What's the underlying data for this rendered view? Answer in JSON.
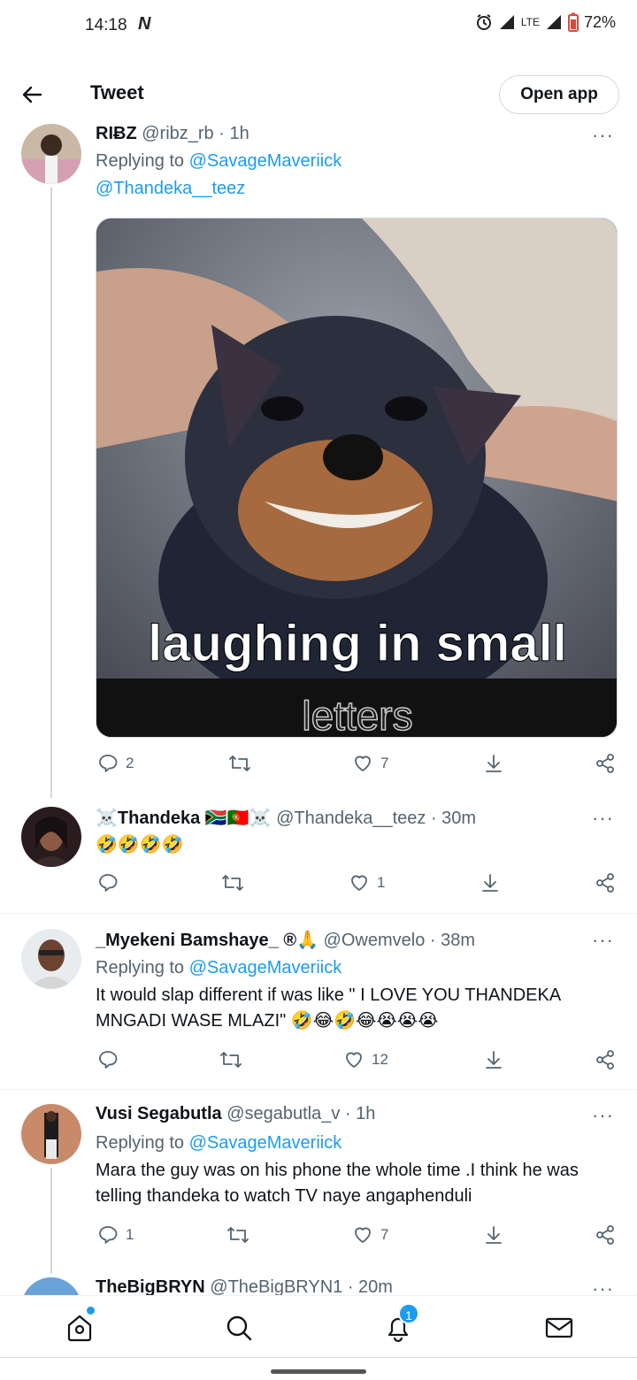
{
  "status_bar": {
    "time": "14:18",
    "carrier_icon": "N",
    "network": "LTE",
    "battery": "72%"
  },
  "topbar": {
    "title": "Tweet",
    "open_app_label": "Open app"
  },
  "tweets": [
    {
      "name": "RIɃZ",
      "handle": "@ribz_rb · 1h",
      "replying_label": "Replying to",
      "replying_to_1": "@SavageMaveriick",
      "replying_to_2": "@Thandeka__teez",
      "media_caption_1": "laughing in small",
      "media_caption_2": "letters",
      "replies": "2",
      "likes": "7",
      "more": "···"
    },
    {
      "name": "☠️Thandeka 🇿🇦🇵🇹☠️",
      "handle": "@Thandeka__teez · 30m",
      "text": "🤣🤣🤣🤣",
      "replies": "",
      "likes": "1",
      "more": "···"
    },
    {
      "name": "_Myekeni Bamshaye_ ®🙏",
      "handle": "@Owemvelo · 38m",
      "replying_label": "Replying to",
      "replying_to_1": "@SavageMaveriick",
      "text": "It would slap different if was like \" I LOVE YOU THANDEKA MNGADI WASE MLAZI\" 🤣😂🤣😂😭😭😭",
      "replies": "",
      "likes": "12",
      "more": "···"
    },
    {
      "name": "Vusi Segabutla",
      "handle": "@segabutla_v · 1h",
      "replying_label": "Replying to",
      "replying_to_1": "@SavageMaveriick",
      "text": "Mara the guy was on his phone the whole time .I think he was telling thandeka to watch TV naye angaphenduli",
      "replies": "1",
      "likes": "7",
      "more": "···"
    },
    {
      "name": "TheBigBRYN",
      "handle": "@TheBigBRYN1 · 20m",
      "more": "···"
    }
  ],
  "bottom_nav": {
    "notifications_badge": "1"
  },
  "colors": {
    "accent": "#1d9bf0",
    "text": "#0f1419",
    "muted": "#536471",
    "border": "#cfd9de"
  }
}
